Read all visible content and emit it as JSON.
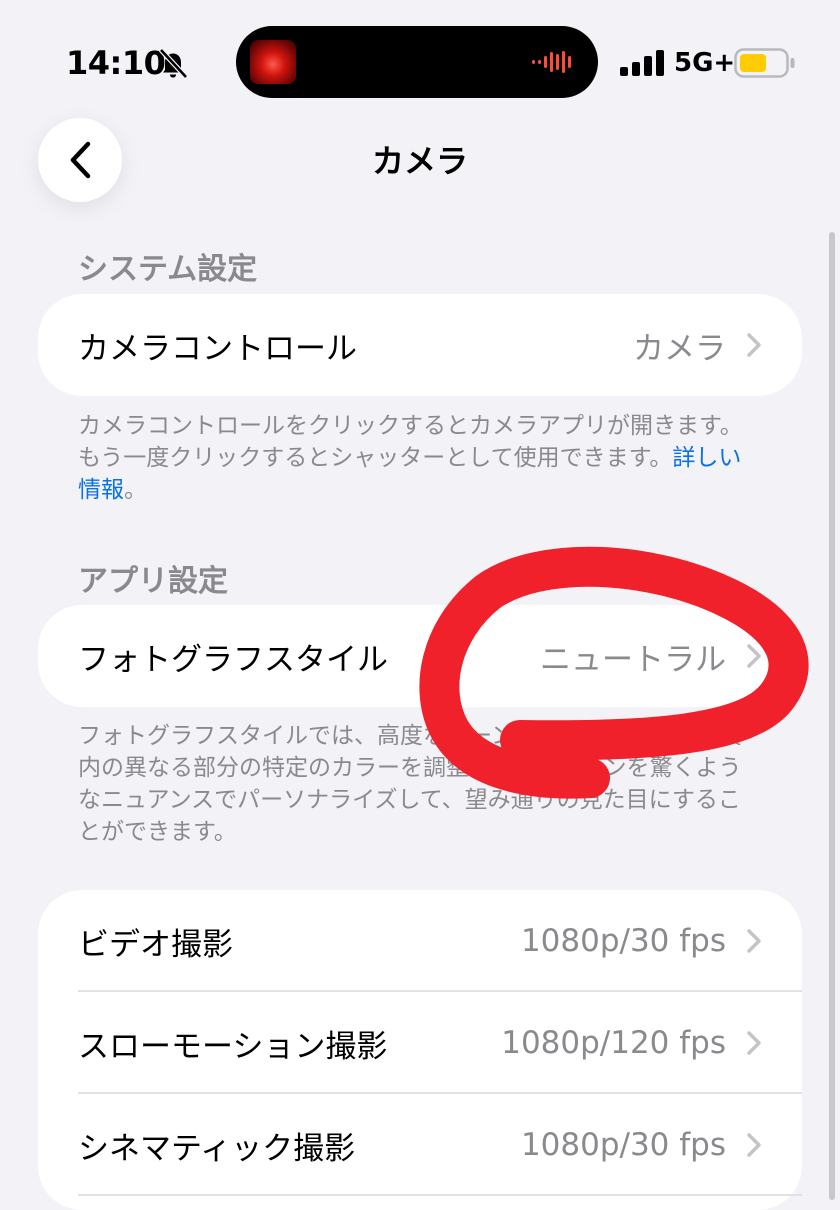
{
  "status_bar": {
    "time": "14:10",
    "silent_icon": "bell-slash-icon",
    "network": "5G+",
    "battery_color": "#ffcc00"
  },
  "nav": {
    "back_icon": "chevron-left-icon",
    "title": "カメラ"
  },
  "system_section": {
    "header": "システム設定",
    "rows": [
      {
        "label": "カメラコントロール",
        "value": "カメラ"
      }
    ],
    "footer": "カメラコントロールをクリックするとカメラアプリが開きます。もう一度クリックするとシャッターとして使用できます。",
    "footer_link": "詳しい情報",
    "footer_link_suffix": "。"
  },
  "app_section": {
    "header": "アプリ設定",
    "rows": [
      {
        "label": "フォトグラフスタイル",
        "value": "ニュートラル"
      }
    ],
    "footer": "フォトグラフスタイルでは、高度なシーン理解を使用して、写真内の異なる部分の特定のカラーを調整します。トーンを驚くようなニュアンスでパーソナライズして、望み通りの見た目にすることができます。"
  },
  "video_section": {
    "rows": [
      {
        "label": "ビデオ撮影",
        "value": "1080p/30 fps"
      },
      {
        "label": "スローモーション撮影",
        "value": "1080p/120 fps"
      },
      {
        "label": "シネマティック撮影",
        "value": "1080p/30 fps"
      }
    ]
  },
  "colors": {
    "annotation_red": "#f0212b",
    "link_blue": "#0a72e6",
    "secondary_gray": "#8a8a8e"
  }
}
